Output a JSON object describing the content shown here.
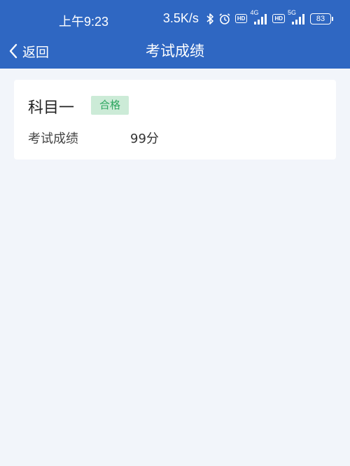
{
  "status_bar": {
    "time": "上午9:23",
    "net_speed": "3.5K/s",
    "hd_1": "HD",
    "sig1_label": "4G",
    "hd_2": "HD",
    "sig2_label": "5G",
    "battery": "83"
  },
  "header": {
    "back_label": "返回",
    "title": "考试成绩"
  },
  "card": {
    "subject": "科目一",
    "status_badge": "合格",
    "score_label": "考试成绩",
    "score_value": "99分"
  },
  "colors": {
    "header_bg": "#2f67c2",
    "page_bg": "#f2f5fa",
    "badge_bg": "#ccebd7",
    "badge_text": "#2ea660"
  },
  "icons": [
    "back-chevron-icon",
    "bluetooth-icon",
    "alarm-icon",
    "signal-icon",
    "battery-icon"
  ]
}
